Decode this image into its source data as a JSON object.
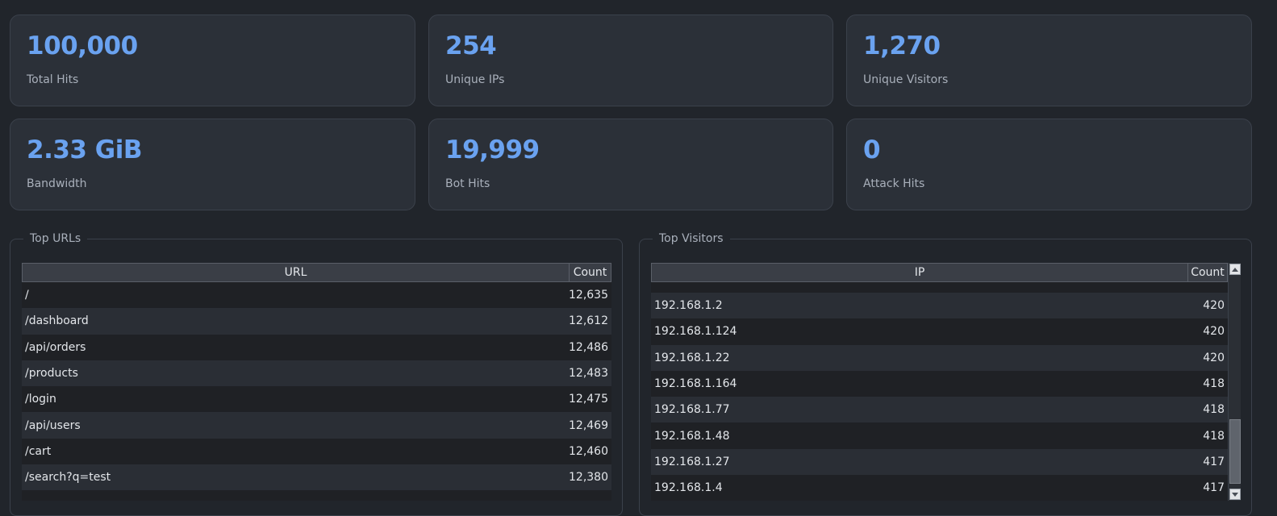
{
  "cards": [
    {
      "value": "100,000",
      "label": "Total Hits"
    },
    {
      "value": "254",
      "label": "Unique IPs"
    },
    {
      "value": "1,270",
      "label": "Unique Visitors"
    },
    {
      "value": "2.33 GiB",
      "label": "Bandwidth"
    },
    {
      "value": "19,999",
      "label": "Bot Hits"
    },
    {
      "value": "0",
      "label": "Attack Hits"
    }
  ],
  "top_urls": {
    "title": "Top URLs",
    "columns": [
      "URL",
      "Count"
    ],
    "rows": [
      {
        "url": "/",
        "count": "12,635"
      },
      {
        "url": "/dashboard",
        "count": "12,612"
      },
      {
        "url": "/api/orders",
        "count": "12,486"
      },
      {
        "url": "/products",
        "count": "12,483"
      },
      {
        "url": "/login",
        "count": "12,475"
      },
      {
        "url": "/api/users",
        "count": "12,469"
      },
      {
        "url": "/cart",
        "count": "12,460"
      },
      {
        "url": "/search?q=test",
        "count": "12,380"
      }
    ]
  },
  "top_visitors": {
    "title": "Top Visitors",
    "columns": [
      "IP",
      "Count"
    ],
    "rows": [
      {
        "ip": "192.168.1.2",
        "count": "420"
      },
      {
        "ip": "192.168.1.124",
        "count": "420"
      },
      {
        "ip": "192.168.1.22",
        "count": "420"
      },
      {
        "ip": "192.168.1.164",
        "count": "418"
      },
      {
        "ip": "192.168.1.77",
        "count": "418"
      },
      {
        "ip": "192.168.1.48",
        "count": "418"
      },
      {
        "ip": "192.168.1.27",
        "count": "417"
      },
      {
        "ip": "192.168.1.4",
        "count": "417"
      }
    ],
    "scroll_position": 0.9
  },
  "icons": {
    "scroll_up": "scroll-up-arrow-icon",
    "scroll_down": "scroll-down-arrow-icon"
  },
  "colors": {
    "accent": "#6aa2f0",
    "background": "#21252b",
    "card": "#2b3038"
  }
}
